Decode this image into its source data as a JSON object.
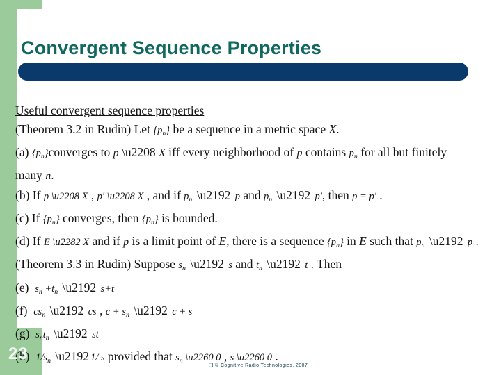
{
  "slide": {
    "title": "Convergent Sequence Properties",
    "page_number": "23",
    "footer": "© Cognitive Radio Technologies, 2007",
    "footer_box_glyph": "❑",
    "colors": {
      "title_text": "#11685f",
      "title_rule": "#0a3a6b",
      "side_bar": "#9bcb9b",
      "page_number_text": "#f4f8f4",
      "body_text": "#141414",
      "background": "#ffffff"
    }
  },
  "body": {
    "heading": "Useful convergent sequence properties",
    "lines": [
      {
        "id": "theorem-3-2",
        "label": "",
        "text": "(Theorem 3.2 in Rudin) Let {pₙ} be a sequence in a metric space X."
      },
      {
        "id": "item-a",
        "label": "(a)",
        "text": "{pₙ} converges to p ∈ X iff every neighborhood of p contains pₙ for all but finitely"
      },
      {
        "id": "item-a-cont",
        "label": "",
        "text": "many n."
      },
      {
        "id": "item-b",
        "label": "(b)",
        "text": "If p ∈ X , p' ∈ X , and if pₙ → p and pₙ → p', then p = p' ."
      },
      {
        "id": "item-c",
        "label": "(c)",
        "text": "If {pₙ} converges, then {pₙ} is bounded."
      },
      {
        "id": "item-d",
        "label": "(d)",
        "text": "If E ⊂ X and if p is a limit point of E, there is a sequence {pₙ} in E such that pₙ → p ."
      },
      {
        "id": "theorem-3-3",
        "label": "",
        "text": "(Theorem 3.3 in Rudin) Suppose sₙ → s and tₙ → t . Then"
      },
      {
        "id": "item-e",
        "label": "(e)",
        "text": "sₙ + tₙ → s+t"
      },
      {
        "id": "item-f",
        "label": "(f)",
        "text": "csₙ → cs , c + sₙ → c + s"
      },
      {
        "id": "item-g",
        "label": "(g)",
        "text": "sₙtₙ → st"
      },
      {
        "id": "item-h",
        "label": "(h)",
        "text": "1/sₙ → 1/s provided that sₙ ≠ 0 , s ≠ 0 ."
      }
    ]
  }
}
